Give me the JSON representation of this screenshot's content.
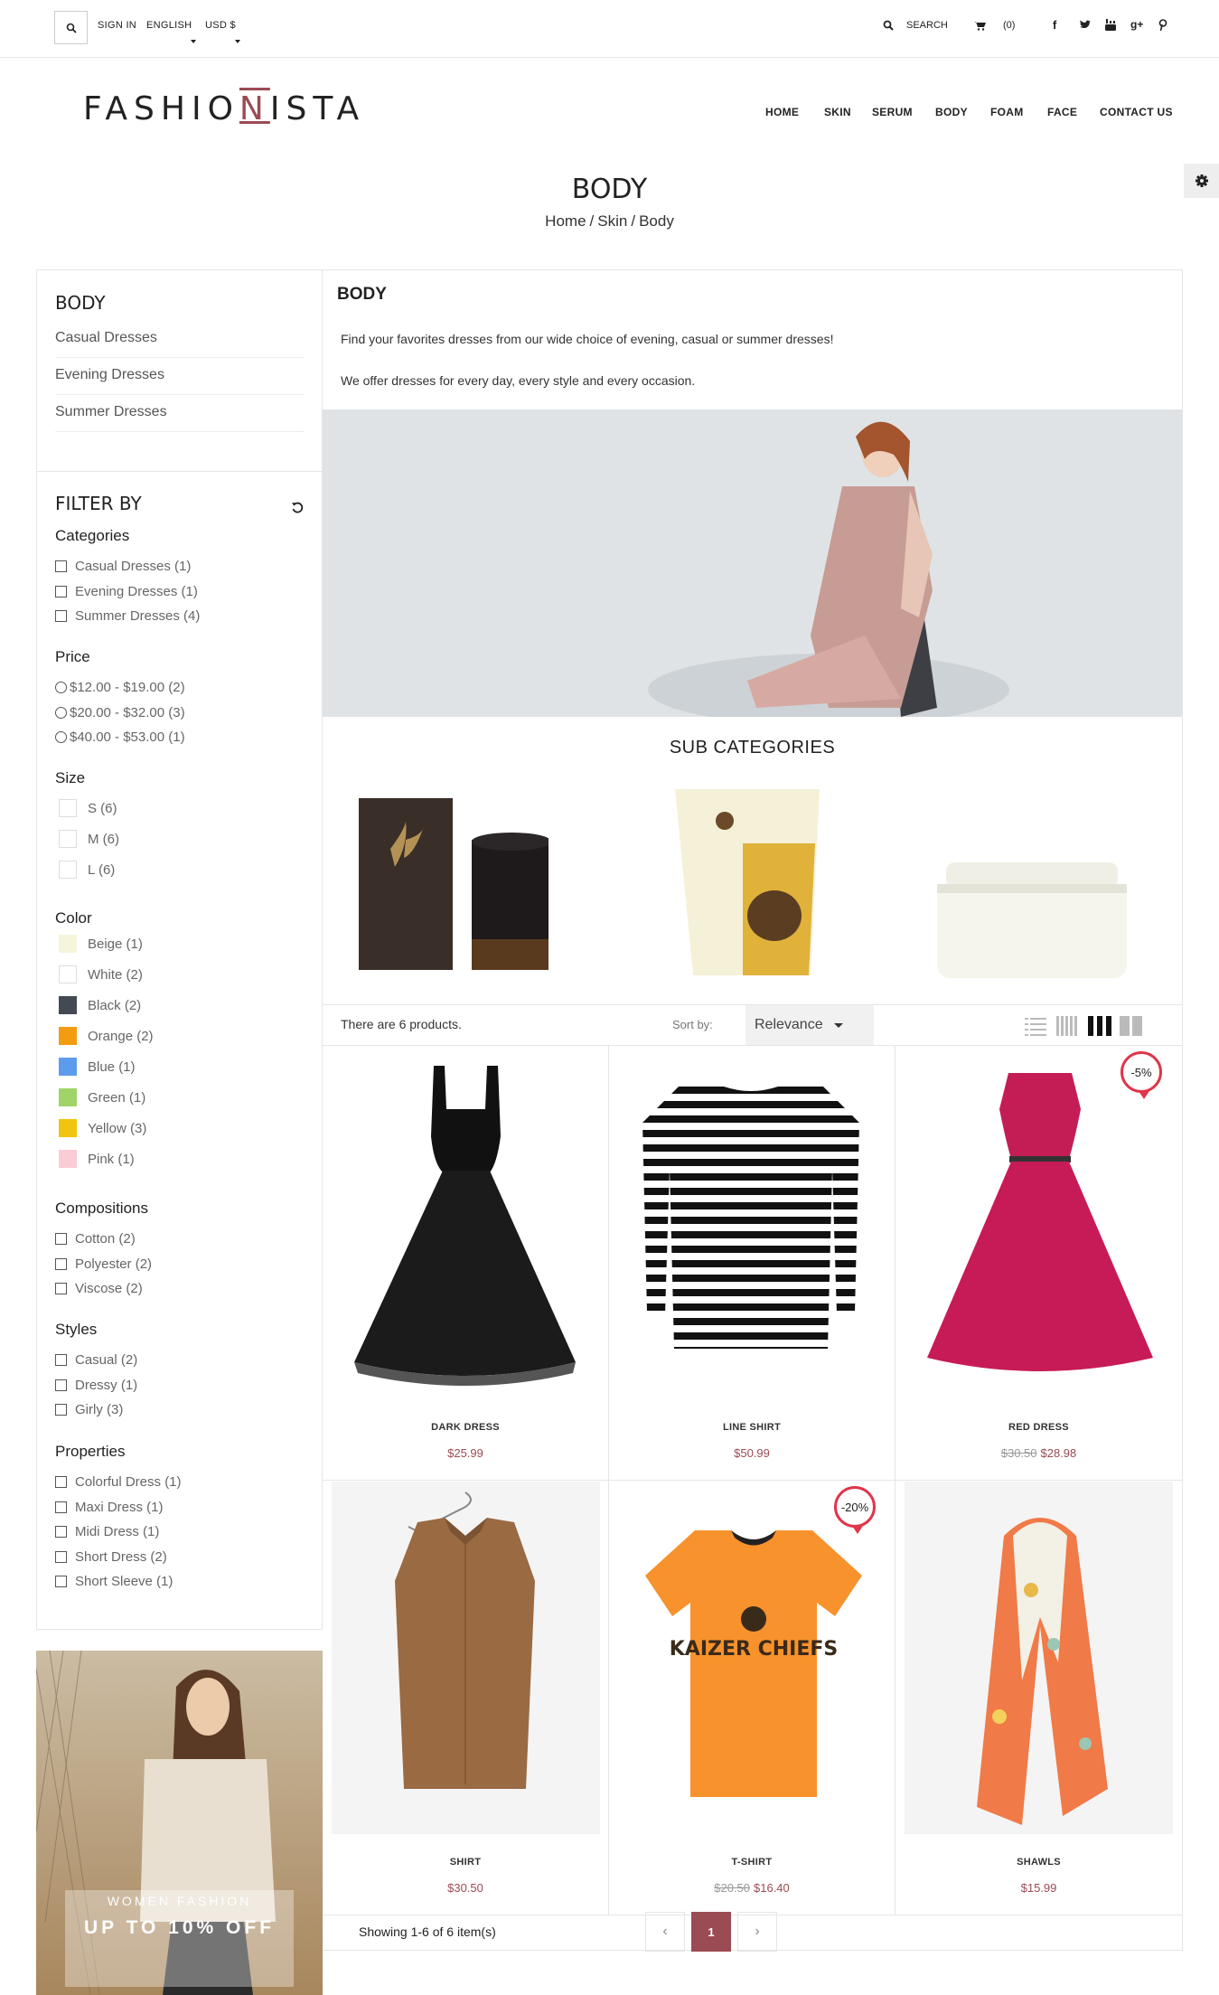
{
  "topbar": {
    "sign_in": "SIGN IN",
    "language": "ENGLISH",
    "currency": "USD $",
    "search": "SEARCH",
    "cart_count": "(0)"
  },
  "header": {
    "logo_pre": "FASHIO",
    "logo_mid": "N",
    "logo_post": "ISTA",
    "nav": [
      "HOME",
      "SKIN",
      "SERUM",
      "BODY",
      "FOAM",
      "FACE",
      "CONTACT US"
    ]
  },
  "page": {
    "title": "BODY",
    "breadcrumb": [
      "Home",
      "Skin",
      "Body"
    ]
  },
  "sidebar": {
    "category_title": "BODY",
    "categories": [
      "Casual Dresses",
      "Evening Dresses",
      "Summer Dresses"
    ],
    "filter_title": "FILTER BY",
    "sections": {
      "categories": {
        "title": "Categories",
        "items": [
          "Casual Dresses (1)",
          "Evening Dresses (1)",
          "Summer Dresses (4)"
        ]
      },
      "price": {
        "title": "Price",
        "items": [
          "$12.00 - $19.00 (2)",
          "$20.00 - $32.00 (3)",
          "$40.00 - $53.00 (1)"
        ]
      },
      "size": {
        "title": "Size",
        "items": [
          "S (6)",
          "M (6)",
          "L (6)"
        ]
      },
      "color": {
        "title": "Color",
        "items": [
          {
            "label": "Beige (1)",
            "hex": "#f5f5dc"
          },
          {
            "label": "White (2)",
            "hex": "#ffffff"
          },
          {
            "label": "Black (2)",
            "hex": "#434a54"
          },
          {
            "label": "Orange (2)",
            "hex": "#f39c11"
          },
          {
            "label": "Blue (1)",
            "hex": "#5d9cec"
          },
          {
            "label": "Green (1)",
            "hex": "#a0d468"
          },
          {
            "label": "Yellow (3)",
            "hex": "#f1c40f"
          },
          {
            "label": "Pink (1)",
            "hex": "#fcccd6"
          }
        ]
      },
      "compositions": {
        "title": "Compositions",
        "items": [
          "Cotton (2)",
          "Polyester (2)",
          "Viscose (2)"
        ]
      },
      "styles": {
        "title": "Styles",
        "items": [
          "Casual (2)",
          "Dressy (1)",
          "Girly (3)"
        ]
      },
      "properties": {
        "title": "Properties",
        "items": [
          "Colorful Dress (1)",
          "Maxi Dress (1)",
          "Midi Dress (1)",
          "Short Dress (2)",
          "Short Sleeve (1)"
        ]
      }
    },
    "promo": {
      "line1": "WOMEN FASHION",
      "line2": "UP TO 10% OFF"
    }
  },
  "main": {
    "heading": "BODY",
    "desc1": "Find your favorites dresses from our wide choice of evening, casual or summer dresses!",
    "desc2": "We offer dresses for every day, every style and every occasion.",
    "subcategories_title": "SUB CATEGORIES",
    "product_count": "There are 6 products.",
    "sort_label": "Sort by:",
    "sort_value": "Relevance",
    "showing": "Showing 1-6 of 6 item(s)",
    "current_page": "1"
  },
  "products": [
    {
      "name": "DARK DRESS",
      "price": "$25.99",
      "old_price": "",
      "badge": ""
    },
    {
      "name": "LINE SHIRT",
      "price": "$50.99",
      "old_price": "",
      "badge": ""
    },
    {
      "name": "RED DRESS",
      "price": "$28.98",
      "old_price": "$30.50",
      "badge": "-5%"
    },
    {
      "name": "SHIRT",
      "price": "$30.50",
      "old_price": "",
      "badge": ""
    },
    {
      "name": "T-SHIRT",
      "price": "$16.40",
      "old_price": "$20.50",
      "badge": "-20%"
    },
    {
      "name": "SHAWLS",
      "price": "$15.99",
      "old_price": "",
      "badge": ""
    }
  ],
  "colors": {
    "accent": "#9b4b53",
    "badge": "#e0354b"
  },
  "icons": [
    "search-icon",
    "cart-icon",
    "facebook-icon",
    "twitter-icon",
    "youtube-icon",
    "google-plus-icon",
    "pinterest-icon",
    "gear-icon",
    "reset-icon",
    "list-view-icon",
    "grid-view-icon",
    "prev-icon",
    "next-icon"
  ]
}
